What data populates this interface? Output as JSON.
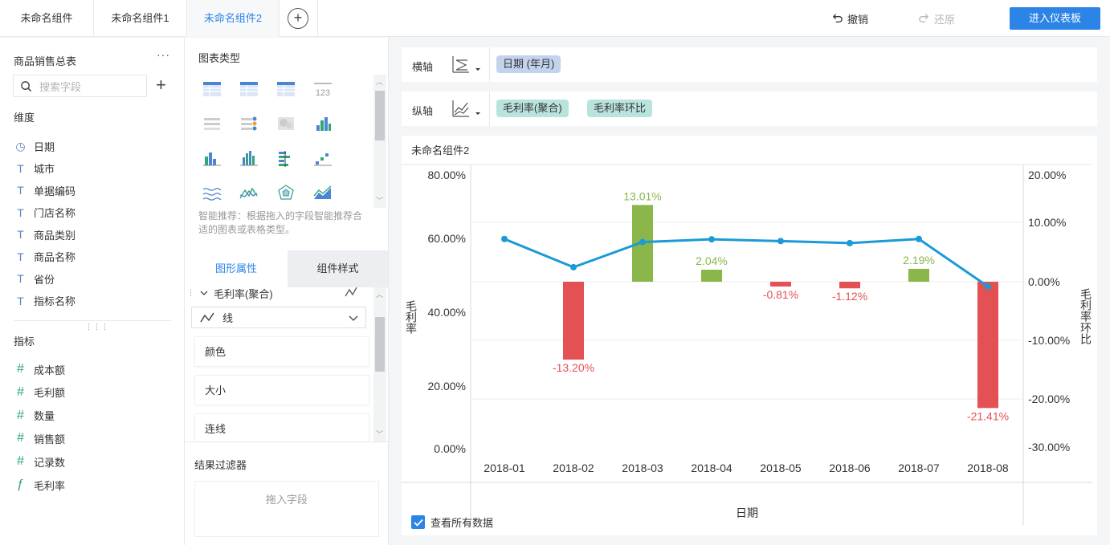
{
  "tabs": [
    "未命名组件",
    "未命名组件1",
    "未命名组件2"
  ],
  "active_tab": 2,
  "toolbar": {
    "undo": "撤销",
    "redo": "还原",
    "enter_dashboard": "进入仪表板"
  },
  "dataset": {
    "name": "商品销售总表",
    "search_placeholder": "搜索字段"
  },
  "dimensions": {
    "title": "维度",
    "items": [
      {
        "label": "日期",
        "icon": "clock-icon"
      },
      {
        "label": "城市",
        "icon": "text-field-icon"
      },
      {
        "label": "单据编码",
        "icon": "text-field-icon"
      },
      {
        "label": "门店名称",
        "icon": "text-field-icon"
      },
      {
        "label": "商品类别",
        "icon": "text-field-icon"
      },
      {
        "label": "商品名称",
        "icon": "text-field-icon"
      },
      {
        "label": "省份",
        "icon": "text-field-icon"
      },
      {
        "label": "指标名称",
        "icon": "text-field-icon"
      }
    ]
  },
  "measures": {
    "title": "指标",
    "items": [
      {
        "label": "成本额",
        "icon": "hash-icon"
      },
      {
        "label": "毛利额",
        "icon": "hash-icon"
      },
      {
        "label": "数量",
        "icon": "hash-icon"
      },
      {
        "label": "销售额",
        "icon": "hash-icon"
      },
      {
        "label": "记录数",
        "icon": "hash-icon"
      },
      {
        "label": "毛利率",
        "icon": "formula-icon"
      }
    ]
  },
  "chart_type_panel": {
    "title": "图表类型",
    "hint": "智能推荐：根据拖入的字段智能推荐合适的图表或表格类型。"
  },
  "prop_tabs": {
    "graph": "图形属性",
    "component": "组件样式"
  },
  "series_props": {
    "series": "毛利率(聚合)",
    "shape": "线",
    "items": [
      "颜色",
      "大小",
      "连线"
    ]
  },
  "filter": {
    "title": "结果过滤器",
    "drop": "拖入字段"
  },
  "axes": {
    "x_label": "横轴",
    "y_label": "纵轴",
    "x_fields": [
      "日期 (年月)"
    ],
    "y_fields": [
      "毛利率(聚合)",
      "毛利率环比"
    ]
  },
  "chart": {
    "name": "未命名组件2",
    "show_all": "查看所有数据"
  },
  "colors": {
    "accent": "#2c84e6",
    "line": "#1a9ad6",
    "bar_pos": "#8ab64a",
    "bar_neg": "#e45154",
    "label_pos": "#8ab64a",
    "label_neg": "#e45154"
  },
  "chart_data": {
    "type": "line+bar",
    "categories": [
      "2018-01",
      "2018-02",
      "2018-03",
      "2018-04",
      "2018-05",
      "2018-06",
      "2018-07",
      "2018-08"
    ],
    "xlabel": "日期",
    "ylabel_left": "毛利率",
    "ylabel_right": "毛利率环比",
    "left_ticks": [
      "80.00%",
      "60.00%",
      "40.00%",
      "20.00%",
      "0.00%"
    ],
    "right_ticks": [
      "20.00%",
      "10.00%",
      "0.00%",
      "-10.00%",
      "-20.00%",
      "-30.00%"
    ],
    "left_ylim": [
      0,
      80
    ],
    "right_ylim": [
      -30,
      20
    ],
    "series": [
      {
        "name": "毛利率",
        "type": "line",
        "axis": "left",
        "values": [
          61.4,
          53.2,
          60.5,
          61.3,
          60.8,
          60.2,
          61.4,
          47.6
        ]
      },
      {
        "name": "毛利率环比",
        "type": "bar",
        "axis": "right",
        "values": [
          null,
          -13.2,
          13.01,
          2.04,
          -0.81,
          -1.12,
          2.19,
          -21.41
        ],
        "labels": [
          "",
          "-13.20%",
          "13.01%",
          "2.04%",
          "-0.81%",
          "-1.12%",
          "2.19%",
          "-21.41%"
        ]
      }
    ]
  }
}
